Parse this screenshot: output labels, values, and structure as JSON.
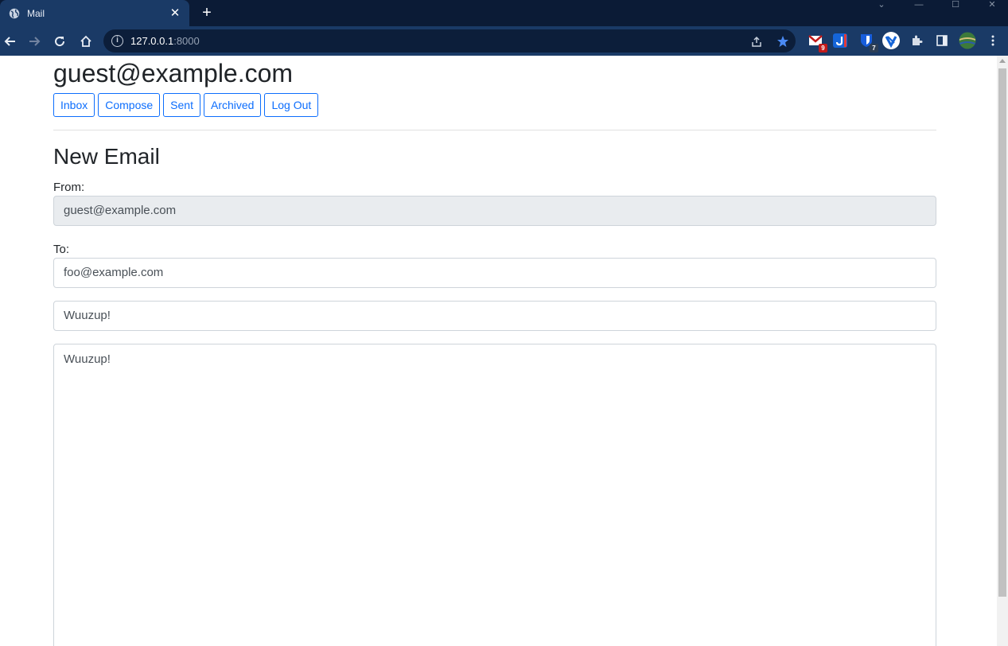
{
  "browser": {
    "tab_title": "Mail",
    "tab_close": "✕",
    "new_tab": "+",
    "url_host": "127.0.0.1",
    "url_port": ":8000",
    "ext_badges": {
      "mail": "9",
      "bitwarden": "7"
    },
    "colors": {
      "chrome_dark": "#0b1b36",
      "chrome": "#1a3a66",
      "omnibox": "#0c1e3a",
      "star": "#4a8af4"
    }
  },
  "header": {
    "user_email": "guest@example.com",
    "nav": {
      "inbox": "Inbox",
      "compose": "Compose",
      "sent": "Sent",
      "archived": "Archived",
      "logout": "Log Out"
    }
  },
  "compose": {
    "title": "New Email",
    "from_label": "From:",
    "from_value": "guest@example.com",
    "to_label": "To:",
    "to_value": "foo@example.com",
    "subject_value": "Wuuzup!",
    "body_value": "Wuuzup!"
  },
  "colors": {
    "accent": "#0d6efd",
    "text": "#212529",
    "disabled_bg": "#e9ecef"
  }
}
